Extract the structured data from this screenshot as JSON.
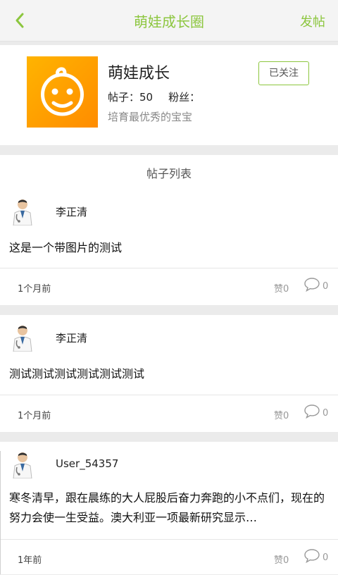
{
  "header": {
    "title": "萌娃成长圈",
    "post_button": "发帖"
  },
  "group": {
    "name": "萌娃成长",
    "stats": {
      "posts_label": "帖子：50",
      "fans_label": "粉丝："
    },
    "description": "培育最优秀的宝宝",
    "follow_button": "已关注",
    "logo_icon": "baby-face-icon"
  },
  "list": {
    "title": "帖子列表",
    "posts": [
      {
        "author": "李正清",
        "text": "这是一个带图片的测试",
        "time": "1个月前",
        "likes": "赞0",
        "comments": "0"
      },
      {
        "author": "李正清",
        "text": "测试测试测试测试测试测试",
        "time": "1个月前",
        "likes": "赞0",
        "comments": "0"
      },
      {
        "author": "User_54357",
        "text": "寒冬清早，跟在晨练的大人屁股后奋力奔跑的小不点们，现在的努力会使一生受益。澳大利亚一项最新研究显示…",
        "time": "1年前",
        "likes": "赞0",
        "comments": "0"
      }
    ]
  },
  "colors": {
    "accent": "#8cc63e",
    "logo_orange": "#ff9f00",
    "background": "#ebebeb"
  }
}
